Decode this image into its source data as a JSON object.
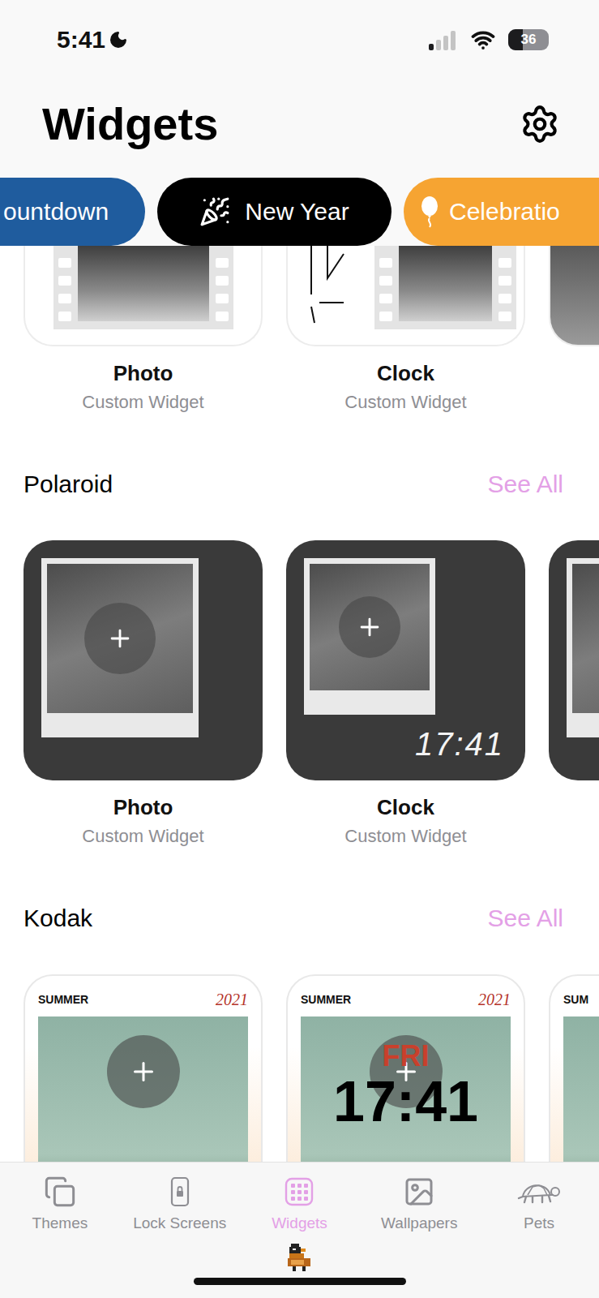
{
  "status_bar": {
    "time": "5:41",
    "signal_level": 0.25,
    "battery": "36",
    "battery_level": 0.36
  },
  "header": {
    "title": "Widgets"
  },
  "categories": [
    {
      "label": "ountdown",
      "selected": false,
      "color": "#1f5c9e"
    },
    {
      "label": "New Year",
      "selected": true,
      "color": "#000000"
    },
    {
      "label": "Celebratio",
      "selected": false,
      "color": "#f6a432"
    }
  ],
  "scrolled_section": {
    "items": [
      {
        "kind": "photo",
        "title": "Photo",
        "subtitle": "Custom Widget"
      },
      {
        "kind": "clock",
        "title": "Clock",
        "subtitle": "Custom Widget"
      },
      {
        "kind": "partial"
      }
    ]
  },
  "sections": [
    {
      "kind": "polaroid",
      "title": "Polaroid",
      "see_all": "See All",
      "items": [
        {
          "kind": "photo",
          "title": "Photo",
          "subtitle": "Custom Widget"
        },
        {
          "kind": "clock",
          "title": "Clock",
          "subtitle": "Custom Widget",
          "time": "17:41"
        },
        {
          "kind": "partial"
        }
      ]
    },
    {
      "kind": "kodak",
      "title": "Kodak",
      "see_all": "See All",
      "items": [
        {
          "kind": "photo",
          "season": "SUMMER",
          "year": "2021"
        },
        {
          "kind": "clock",
          "season": "SUMMER",
          "year": "2021",
          "day": "FRI",
          "time": "17:41"
        },
        {
          "kind": "partial",
          "season": "SUM"
        }
      ]
    }
  ],
  "tabs": [
    {
      "label": "Themes",
      "selected": false
    },
    {
      "label": "Lock Screens",
      "selected": false
    },
    {
      "label": "Widgets",
      "selected": true
    },
    {
      "label": "Wallpapers",
      "selected": false
    },
    {
      "label": "Pets",
      "selected": false
    }
  ]
}
